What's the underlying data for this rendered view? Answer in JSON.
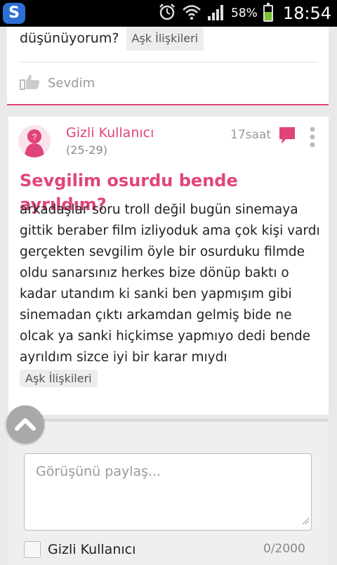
{
  "statusbar": {
    "app_letter": "S",
    "battery_percent": "58%",
    "time": "18:54",
    "icons": [
      "alarm-icon",
      "wifi-icon",
      "signal-icon",
      "battery-icon"
    ]
  },
  "prev_post": {
    "text_end": "düşünüyorum?",
    "tag": "Aşk İlişkileri",
    "like_label": "Sevdim"
  },
  "post": {
    "author": "Gizli Kullanıcı",
    "age": "(25-29)",
    "time_ago": "17saat",
    "title": "Sevgilim osurdu bende ayrıldım?",
    "body": "arkadaşlar soru troll değil bugün sinemaya gittik beraber film izliyoduk ama çok kişi vardı gerçekten sevgilim öyle bir osurduku filmde oldu sanarsınız herkes bize dönüp baktı o kadar utandım ki sanki ben yapmışım gibi sinemadan çıktı arkamdan gelmiş bide ne olcak ya sanki hiçkimse yapmıyo dedi bende ayrıldım sizce iyi bir karar mıydı",
    "tag": "Aşk İlişkileri",
    "avatar_mark": "?"
  },
  "comment": {
    "placeholder": "Görüşünü paylaş...",
    "anonymous_label": "Gizli Kullanıcı",
    "counter": "0/2000"
  },
  "colors": {
    "accent": "#e0447c",
    "status_bg": "#000000",
    "page_bg": "#e9e9e9"
  }
}
